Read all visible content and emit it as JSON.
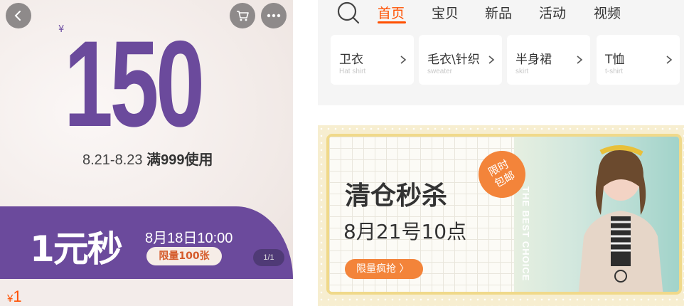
{
  "left": {
    "yen_symbol": "¥",
    "amount": "150",
    "condition_dates": "8.21-8.23",
    "condition_rule": "满999使用",
    "banner_title": "1元秒",
    "banner_time": "8月18日10:00",
    "banner_limit": "限量100张",
    "pager": "1/1",
    "price_symbol": "¥",
    "price_value": "1"
  },
  "right": {
    "tabs": [
      {
        "label": "首页",
        "active": true
      },
      {
        "label": "宝贝",
        "active": false
      },
      {
        "label": "新品",
        "active": false
      },
      {
        "label": "活动",
        "active": false
      },
      {
        "label": "视频",
        "active": false
      }
    ],
    "categories": [
      {
        "cn": "卫衣",
        "en": "Hat shirt"
      },
      {
        "cn": "毛衣\\针织",
        "en": "sweater"
      },
      {
        "cn": "半身裙",
        "en": "skirt"
      },
      {
        "cn": "T恤",
        "en": "t-shirt"
      }
    ],
    "promo": {
      "title": "清仓秒杀",
      "date": "8月21号10点",
      "button": "限量疯抢 〉",
      "stamp_line1": "限时",
      "stamp_line2": "包邮",
      "vertical_text": "THE BEST CHOICE"
    }
  },
  "colors": {
    "purple": "#6b4a9c",
    "accent_orange": "#ff5000",
    "promo_orange": "#f3843a"
  }
}
